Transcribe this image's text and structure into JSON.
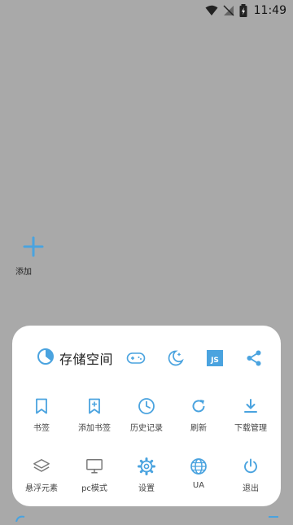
{
  "status_bar": {
    "time": "11:49"
  },
  "add_shortcut": {
    "label": "添加"
  },
  "menu": {
    "storage_label": "存储空间",
    "top_icons": [
      "gamepad-icon",
      "night-mode-icon",
      "javascript-icon",
      "share-icon"
    ],
    "js_badge": "JS",
    "row1": [
      {
        "label": "书签",
        "icon": "bookmark-icon"
      },
      {
        "label": "添加书签",
        "icon": "add-bookmark-icon"
      },
      {
        "label": "历史记录",
        "icon": "history-icon"
      },
      {
        "label": "刷新",
        "icon": "refresh-icon"
      },
      {
        "label": "下载管理",
        "icon": "download-icon"
      }
    ],
    "row2": [
      {
        "label": "悬浮元素",
        "icon": "layers-icon"
      },
      {
        "label": "pc模式",
        "icon": "monitor-icon"
      },
      {
        "label": "设置",
        "icon": "gear-icon"
      },
      {
        "label": "UA",
        "icon": "globe-icon"
      },
      {
        "label": "退出",
        "icon": "power-icon"
      }
    ]
  },
  "colors": {
    "accent": "#4aa3df",
    "gray_icon": "#777777",
    "overlay": "#a9a9a9",
    "panel": "#ffffff"
  }
}
